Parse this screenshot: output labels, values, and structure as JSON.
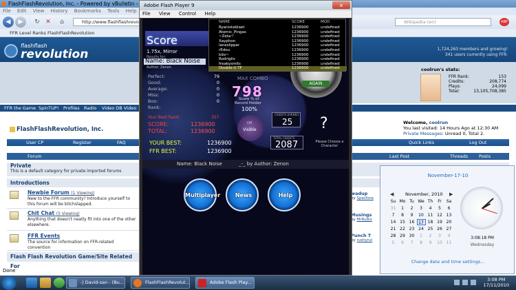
{
  "firefox": {
    "title": "FlashFlashRevolution, Inc. - Powered by vBulletin - Mozilla Firefox",
    "menu": [
      "File",
      "Edit",
      "View",
      "History",
      "Bookmarks",
      "Tools",
      "Help"
    ],
    "url": "http://www.flashflashrevolution.com/vbz/index.php",
    "search_placeholder": "Wikipedia (en)",
    "tab_label": "FFR Level Ranks FlashFlashRevolution",
    "status": "Done"
  },
  "site": {
    "logo_small": "flashflash",
    "logo_main": "revolution",
    "online": "1,724,263 members and growing!",
    "online2": "341 users currently using FFR.",
    "nav": [
      "FFR the Game",
      "SpinTUP!",
      "Profiles",
      "Radio",
      "Video DB",
      "Video"
    ],
    "forum_title": "FlashFlashRevolution, Inc.",
    "welcome": "Welcome,",
    "user": "coolrun",
    "last_visited": "You last visited: 14 Hours Ago at 12:30 AM",
    "pm": "Private Messages",
    "pm_rest": ": Unread 0, Total 2.",
    "bar2": [
      "User CP",
      "Register",
      "FAQ",
      "Quick Links",
      "Log Out"
    ],
    "col_forum": "Forum",
    "col_last": "Last Post",
    "col_threads": "Threads",
    "col_posts": "Posts",
    "stats_title": "coolrun's stats:",
    "stats": [
      {
        "label": "FFR Rank:",
        "value": "153"
      },
      {
        "label": "Credits:",
        "value": "208,774"
      },
      {
        "label": "Plays:",
        "value": "24,099"
      },
      {
        "label": "Total:",
        "value": "13,105,708,385"
      }
    ],
    "private_title": "Private",
    "private_desc": "This is a default category for private imported forums",
    "intro_title": "Introductions",
    "forums": [
      {
        "title": "Newbie Forum",
        "views": "(1 Viewing)",
        "desc": "New to the FFR community? Introduce yourself to this forum will be bitchslapped.",
        "last": "wadup",
        "by": "Specfora"
      },
      {
        "title": "Chit Chat",
        "views": "(5 Viewing)",
        "desc": "Anything that doesn't neatly fit into one of the other elsewhere.",
        "last": "Musings",
        "by": "MrRubix"
      },
      {
        "title": "FFR Events",
        "views": "",
        "desc": "The source for information on FFR-related convention",
        "last": "Punch T",
        "by": "rushyrul"
      }
    ],
    "section3": "Flash Flash Revolution Game/Site Related For"
  },
  "flash": {
    "title": "Adobe Flash Player 9",
    "close": "x",
    "menu": [
      "File",
      "View",
      "Control",
      "Help"
    ],
    "score_heading": "Score",
    "mods": "1.75x, Mirror",
    "results_for": "Results for:",
    "song_name": "Name: Black Noise",
    "author_small": "Author: Zenon",
    "lb_headers": [
      "NAME",
      "SCORE",
      "MOD"
    ],
    "leaderboard": [
      {
        "name": "Ryanistablaet",
        "score": "1236900",
        "mod": "undefined"
      },
      {
        "name": "Atomic_Pingas",
        "score": "1236900",
        "mod": "undefined"
      },
      {
        "name": "~Zeta~",
        "score": "1236900",
        "mod": "undefined"
      },
      {
        "name": "Xayphon",
        "score": "1236900",
        "mod": "undefined"
      },
      {
        "name": "laneslipper",
        "score": "1236900",
        "mod": "undefined"
      },
      {
        "name": "rEdou",
        "score": "1236900",
        "mod": "undefined"
      },
      {
        "name": "kdo~",
        "score": "1236900",
        "mod": "undefined"
      },
      {
        "name": "Rodrigliv",
        "score": "1236900",
        "mod": "undefined"
      },
      {
        "name": "freakysmits",
        "score": "1236900",
        "mod": "undefined"
      },
      {
        "name": "Double-U TF",
        "score": "1236900",
        "mod": "undefined"
      }
    ],
    "judges": [
      {
        "label": "Perfect:",
        "value": "79"
      },
      {
        "label": "Good:",
        "value": "0"
      },
      {
        "label": "Average:",
        "value": "0"
      },
      {
        "label": "Miss:",
        "value": "0"
      },
      {
        "label": "Boo:",
        "value": "0"
      },
      {
        "label": "Rank:",
        "value": ""
      }
    ],
    "max_combo_label": "MAX COMBO",
    "max_combo": "798",
    "record_line1": "Score % of",
    "record_line2": "Record Holder",
    "record_pct": "100%",
    "best_rank_label": "Your Best Rank:",
    "best_rank": "357",
    "score_label": "SCORE:",
    "score_value": "1236900",
    "total_label": "TOTAL:",
    "total_value": "1236900",
    "credits_label": "CREDITS EARNED",
    "credits_value": "25",
    "total_credits_label": "TOTAL CREDITS",
    "total_credits_value": "2087",
    "visible_label": "Visible",
    "off_label": "Off",
    "choose": "Please Choose a Character",
    "your_best_label": "YOUR BEST:",
    "your_best_value": "1236900",
    "ffr_best_label": "FFR BEST:",
    "ffr_best_value": "1236900",
    "footer_name": "Name: Black Noise",
    "footer_author": "_-_ by Author: Zenon",
    "again": "AGAIN",
    "buttons": [
      "Multiplayer",
      "News",
      "Help"
    ]
  },
  "calendar": {
    "date_title": "November-17-10",
    "month": "November, 2010",
    "days": [
      "Su",
      "Mo",
      "Tu",
      "We",
      "Th",
      "Fr",
      "Sa"
    ],
    "weeks": [
      [
        "31",
        "1",
        "2",
        "3",
        "4",
        "5",
        "6"
      ],
      [
        "7",
        "8",
        "9",
        "10",
        "11",
        "12",
        "13"
      ],
      [
        "14",
        "15",
        "16",
        "17",
        "18",
        "19",
        "20"
      ],
      [
        "21",
        "22",
        "23",
        "24",
        "25",
        "26",
        "27"
      ],
      [
        "28",
        "29",
        "30",
        "1",
        "2",
        "3",
        "4"
      ],
      [
        "5",
        "6",
        "7",
        "8",
        "9",
        "10",
        "11"
      ]
    ],
    "time": "3:08:18 PM",
    "weekday": "Wednesday",
    "link": "Change date and time settings..."
  },
  "taskbar": {
    "buttons": [
      "-| David-san - (Bu...",
      "FlashFlashRevolut...",
      "Adobe Flash Play..."
    ],
    "time": "3:08 PM",
    "date": "17/11/2010"
  }
}
